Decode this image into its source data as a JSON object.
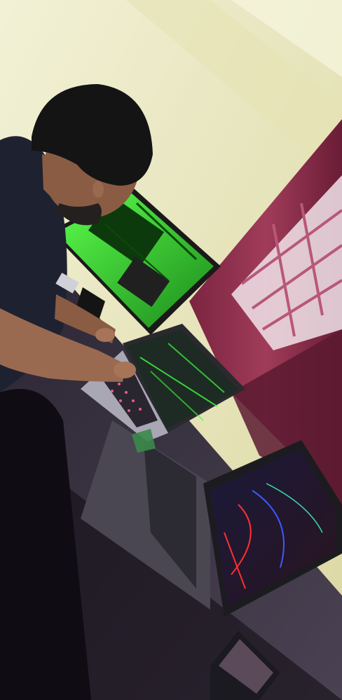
{
  "scene": {
    "description_text": "",
    "colors": {
      "wall": "#ecebc0",
      "wall_shadow": "#d9d6a0",
      "curtain": "#8a2f4a",
      "curtain_dark": "#5a1a2e",
      "window_light": "#f4eef2",
      "desk": "#3a3444",
      "desk_edge": "#4a4454",
      "shirt": "#1e2230",
      "skin": "#9a6a50",
      "hair": "#141414",
      "monitor_frame": "#1c1c1c",
      "screen_green": "#3cff3c",
      "screen_dark_green": "#0c3a0c",
      "laptop_silver": "#a9a7b4",
      "laptop_dark": "#242428",
      "keyboard_backlight": "#ff5fa0",
      "screen_red": "#ff3030",
      "screen_blue": "#2a3a8a"
    }
  }
}
